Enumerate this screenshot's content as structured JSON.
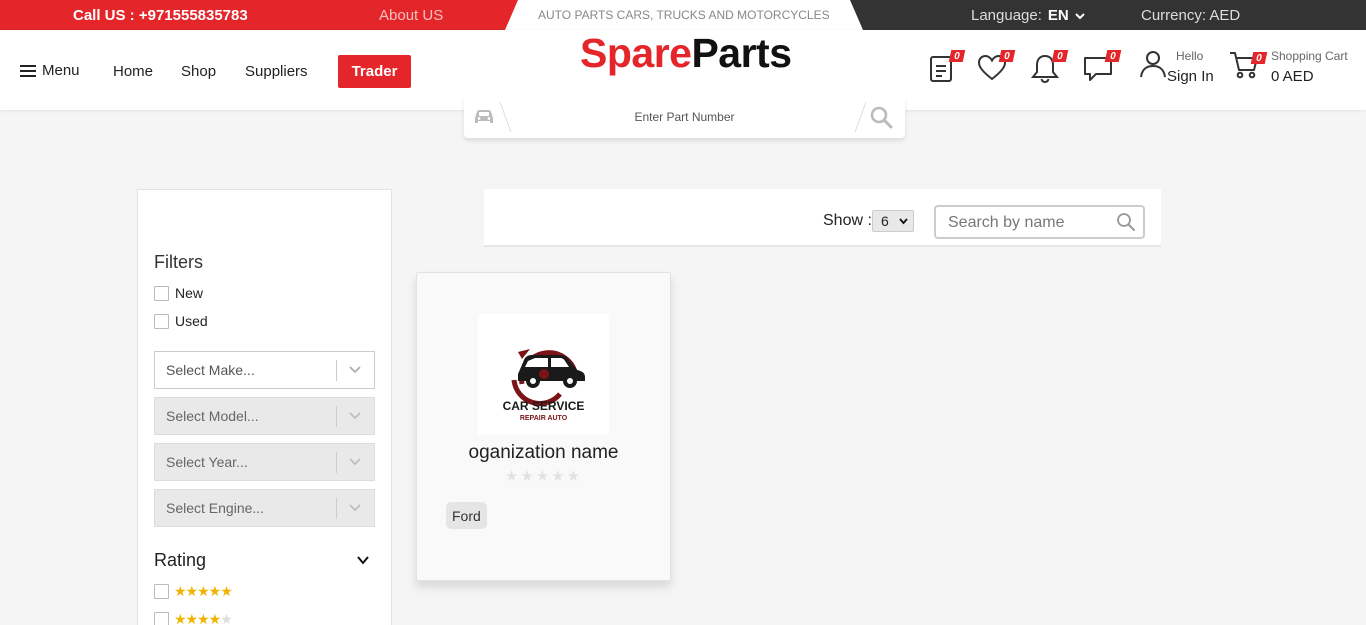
{
  "topbar": {
    "call": "Call US : +971555835783",
    "about": "About US",
    "tagline": "AUTO PARTS CARS, TRUCKS AND MOTORCYCLES",
    "language_label": "Language:",
    "language_value": "EN",
    "currency": "Currency: AED"
  },
  "header": {
    "menu_label": "Menu",
    "nav": {
      "home": "Home",
      "shop": "Shop",
      "suppliers": "Suppliers"
    },
    "trader_label": "Trader",
    "logo_part1": "Spare",
    "logo_part2": "Parts",
    "badges": {
      "orders": "0",
      "wishlist": "0",
      "notifications": "0",
      "messages": "0",
      "cart": "0"
    },
    "hello": "Hello",
    "sign_in": "Sign In",
    "cart_label": "Shopping Cart",
    "cart_amount": "0 AED",
    "icons": [
      "orders-icon",
      "heart-icon",
      "bell-icon",
      "chat-icon",
      "user-icon",
      "cart-icon"
    ]
  },
  "search_strip": {
    "placeholder": "Enter Part Number"
  },
  "filters": {
    "title": "Filters",
    "condition": [
      "New",
      "Used"
    ],
    "selects": [
      "Select Make...",
      "Select Model...",
      "Select Year...",
      "Select Engine..."
    ],
    "rating_title": "Rating",
    "rating_rows": [
      5,
      4
    ]
  },
  "toolbar": {
    "show_label": "Show :",
    "show_value": "6",
    "search_placeholder": "Search by name"
  },
  "card": {
    "logo_text1": "CAR SERVICE",
    "logo_text2": "REPAIR AUTO",
    "org_name": "oganization name",
    "rating": 0,
    "tag": "Ford"
  },
  "colors": {
    "brand_red": "#e4262a",
    "topbar_dark": "#333333",
    "star_gold": "#f0b400"
  }
}
